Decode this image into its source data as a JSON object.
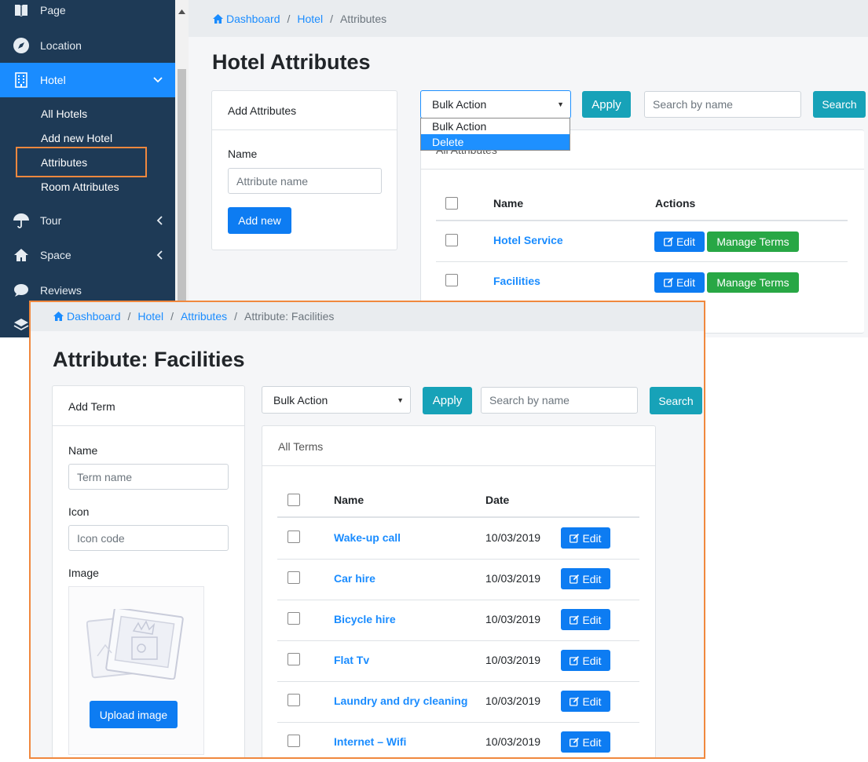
{
  "sidebar": {
    "items": [
      {
        "label": "Page",
        "icon": "book-icon"
      },
      {
        "label": "Location",
        "icon": "compass-icon"
      },
      {
        "label": "Hotel",
        "icon": "building-icon"
      },
      {
        "label": "Tour",
        "icon": "umbrella-icon"
      },
      {
        "label": "Space",
        "icon": "home-icon"
      },
      {
        "label": "Reviews",
        "icon": "comment-icon"
      }
    ],
    "hotel_sub": [
      "All Hotels",
      "Add new Hotel",
      "Attributes",
      "Room Attributes"
    ]
  },
  "top": {
    "breadcrumb": {
      "home": "Dashboard",
      "hotel": "Hotel",
      "current": "Attributes"
    },
    "title": "Hotel Attributes",
    "add_card": {
      "header": "Add Attributes",
      "name_label": "Name",
      "name_placeholder": "Attribute name",
      "add_button": "Add new"
    },
    "bulk_action": "Bulk Action",
    "apply": "Apply",
    "search_placeholder": "Search by name",
    "search": "Search",
    "dropdown_options": [
      "Bulk Action",
      "Delete"
    ],
    "list_header": "All Attributes",
    "columns": {
      "name": "Name",
      "actions": "Actions"
    },
    "rows": [
      {
        "name": "Hotel Service",
        "edit": "Edit",
        "manage": "Manage Terms"
      },
      {
        "name": "Facilities",
        "edit": "Edit",
        "manage": "Manage Terms"
      }
    ]
  },
  "overlay": {
    "breadcrumb": {
      "home": "Dashboard",
      "hotel": "Hotel",
      "attributes": "Attributes",
      "current": "Attribute: Facilities"
    },
    "title": "Attribute: Facilities",
    "add_card": {
      "header": "Add Term",
      "name_label": "Name",
      "name_placeholder": "Term name",
      "icon_label": "Icon",
      "icon_placeholder": "Icon code",
      "image_label": "Image",
      "upload_button": "Upload image"
    },
    "bulk_action": "Bulk Action",
    "apply": "Apply",
    "search_placeholder": "Search by name",
    "search": "Search",
    "list_header": "All Terms",
    "columns": {
      "name": "Name",
      "date": "Date"
    },
    "rows": [
      {
        "name": "Wake-up call",
        "date": "10/03/2019",
        "edit": "Edit"
      },
      {
        "name": "Car hire",
        "date": "10/03/2019",
        "edit": "Edit"
      },
      {
        "name": "Bicycle hire",
        "date": "10/03/2019",
        "edit": "Edit"
      },
      {
        "name": "Flat Tv",
        "date": "10/03/2019",
        "edit": "Edit"
      },
      {
        "name": "Laundry and dry cleaning",
        "date": "10/03/2019",
        "edit": "Edit"
      },
      {
        "name": "Internet – Wifi",
        "date": "10/03/2019",
        "edit": "Edit"
      }
    ]
  },
  "colors": {
    "sidebar": "#1e3a56",
    "active": "#1a8cff",
    "accent": "#f0883e",
    "teal": "#17a2b8",
    "green": "#28a745"
  }
}
